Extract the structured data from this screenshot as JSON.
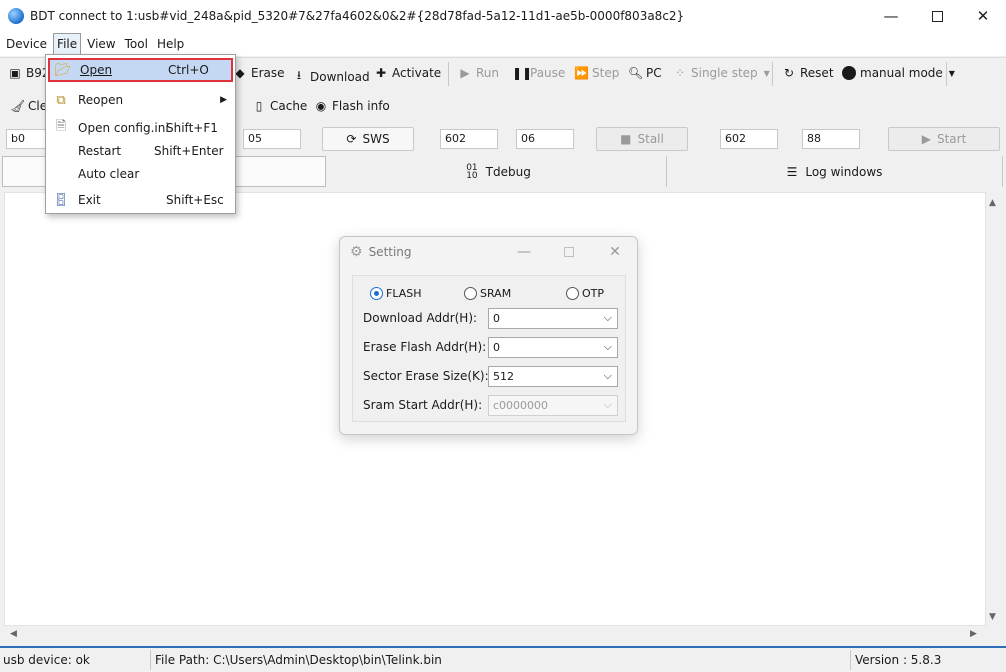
{
  "window": {
    "title": "BDT connect to 1:usb#vid_248a&pid_5320#7&27fa4602&0&2#{28d78fad-5a12-11d1-ae5b-0000f803a8c2}",
    "minimize_glyph": "—",
    "close_glyph": "✕"
  },
  "menubar": {
    "device": "Device",
    "file": "File",
    "view": "View",
    "tool": "Tool",
    "help": "Help"
  },
  "toolbar1": {
    "chip_label": "B92",
    "erase": "Erase",
    "download": "Download",
    "activate": "Activate",
    "run": "Run",
    "pause": "Pause",
    "step": "Step",
    "pc": "PC",
    "single_step": "Single step",
    "reset": "Reset",
    "manual_mode": "manual mode"
  },
  "toolbar2": {
    "clear": "Cle",
    "cache": "Cache",
    "flash_info": "Flash info"
  },
  "toolbar3": {
    "field1": "b0",
    "field2": "05",
    "sws": "SWS",
    "field3": "602",
    "field4": "06",
    "stall": "Stall",
    "field5": "602",
    "field6": "88",
    "start": "Start"
  },
  "tabs": {
    "tdebug": "Tdebug",
    "log_windows": "Log windows"
  },
  "statusbar": {
    "device": "usb device: ok",
    "file_path": "File Path:  C:\\Users\\Admin\\Desktop\\bin\\Telink.bin",
    "version": "Version : 5.8.3"
  },
  "file_menu": {
    "items": [
      {
        "label": "Open",
        "shortcut": "Ctrl+O"
      },
      {
        "label": "Reopen",
        "shortcut": ""
      },
      {
        "label": "Open config.ini",
        "shortcut": "Shift+F1"
      },
      {
        "label": "Restart",
        "shortcut": "Shift+Enter"
      },
      {
        "label": "Auto clear",
        "shortcut": ""
      },
      {
        "label": "Exit",
        "shortcut": "Shift+Esc"
      }
    ]
  },
  "setting_dialog": {
    "title": "Setting",
    "radios": {
      "flash": "FLASH",
      "sram": "SRAM",
      "otp": "OTP"
    },
    "download_addr_label": "Download  Addr(H):",
    "download_addr_value": "0",
    "erase_flash_addr_label": "Erase Flash Addr(H):",
    "erase_flash_addr_value": "0",
    "sector_erase_size_label": "Sector Erase Size(K):",
    "sector_erase_size_value": "512",
    "sram_start_addr_label": "Sram Start Addr(H):",
    "sram_start_addr_value": "c0000000"
  }
}
